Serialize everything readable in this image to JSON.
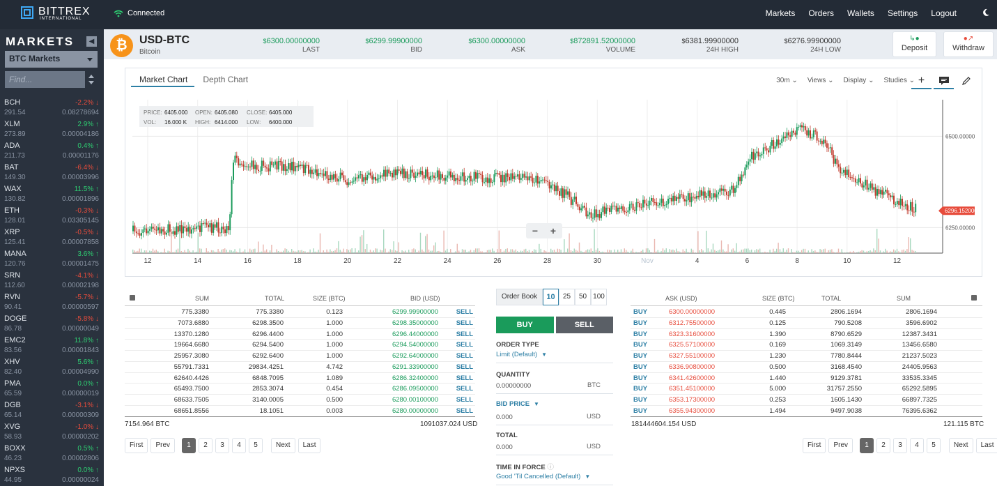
{
  "brand": {
    "name": "BITTREX",
    "sub": "INTERNATIONAL"
  },
  "connection": "Connected",
  "nav": [
    "Markets",
    "Orders",
    "Wallets",
    "Settings",
    "Logout"
  ],
  "sidebar": {
    "title": "MARKETS",
    "select": "BTC Markets",
    "find_placeholder": "Find...",
    "markets": [
      {
        "sym": "BCH",
        "chg": "-2.2%",
        "dir": "down",
        "vol": "291.54",
        "price": "0.08278694"
      },
      {
        "sym": "XLM",
        "chg": "2.9%",
        "dir": "up",
        "vol": "273.89",
        "price": "0.00004186"
      },
      {
        "sym": "ADA",
        "chg": "0.4%",
        "dir": "up",
        "vol": "211.73",
        "price": "0.00001176"
      },
      {
        "sym": "BAT",
        "chg": "-6.4%",
        "dir": "down",
        "vol": "149.30",
        "price": "0.00003996"
      },
      {
        "sym": "WAX",
        "chg": "11.5%",
        "dir": "up",
        "vol": "130.82",
        "price": "0.00001896"
      },
      {
        "sym": "ETH",
        "chg": "-0.3%",
        "dir": "down",
        "vol": "128.01",
        "price": "0.03305145"
      },
      {
        "sym": "XRP",
        "chg": "-0.5%",
        "dir": "down",
        "vol": "125.41",
        "price": "0.00007858"
      },
      {
        "sym": "MANA",
        "chg": "3.6%",
        "dir": "up",
        "vol": "120.76",
        "price": "0.00001475"
      },
      {
        "sym": "SRN",
        "chg": "-4.1%",
        "dir": "down",
        "vol": "112.60",
        "price": "0.00002198"
      },
      {
        "sym": "RVN",
        "chg": "-5.7%",
        "dir": "down",
        "vol": "90.41",
        "price": "0.00000597"
      },
      {
        "sym": "DOGE",
        "chg": "-5.8%",
        "dir": "down",
        "vol": "86.78",
        "price": "0.00000049"
      },
      {
        "sym": "EMC2",
        "chg": "11.8%",
        "dir": "up",
        "vol": "83.56",
        "price": "0.00001843"
      },
      {
        "sym": "XHV",
        "chg": "5.6%",
        "dir": "up",
        "vol": "82.40",
        "price": "0.00004990"
      },
      {
        "sym": "PMA",
        "chg": "0.0%",
        "dir": "zero",
        "vol": "65.59",
        "price": "0.00000019"
      },
      {
        "sym": "DGB",
        "chg": "-3.1%",
        "dir": "down",
        "vol": "65.14",
        "price": "0.00000309"
      },
      {
        "sym": "XVG",
        "chg": "-1.0%",
        "dir": "down",
        "vol": "58.93",
        "price": "0.00000202"
      },
      {
        "sym": "BOXX",
        "chg": "0.5%",
        "dir": "up",
        "vol": "46.23",
        "price": "0.00002806"
      },
      {
        "sym": "NPXS",
        "chg": "0.0%",
        "dir": "zero",
        "vol": "44.95",
        "price": "0.00000024"
      }
    ]
  },
  "ticker": {
    "pair": "USD-BTC",
    "name": "Bitcoin",
    "stats": [
      {
        "cur": "$",
        "value": "6300.00000000",
        "label": "LAST",
        "green": true
      },
      {
        "cur": "$",
        "value": "6299.99900000",
        "label": "BID",
        "green": true
      },
      {
        "cur": "$",
        "value": "6300.00000000",
        "label": "ASK",
        "green": true
      },
      {
        "cur": "$",
        "value": "872891.52000000",
        "label": "VOLUME",
        "green": true
      },
      {
        "cur": "$",
        "value": "6381.99900000",
        "label": "24H HIGH",
        "green": false
      },
      {
        "cur": "$",
        "value": "6276.99900000",
        "label": "24H LOW",
        "green": false
      }
    ],
    "deposit": "Deposit",
    "withdraw": "Withdraw"
  },
  "chart": {
    "tabs": [
      "Market Chart",
      "Depth Chart"
    ],
    "tools": [
      "30m",
      "Views",
      "Display",
      "Studies"
    ],
    "ohlc": {
      "price": "6405.000",
      "open": "6405.080",
      "close": "6405.000",
      "vol": "16.000 K",
      "high": "6414.000",
      "low": "6400.000"
    },
    "ohlc_labels": {
      "price": "PRICE:",
      "open": "OPEN:",
      "close": "CLOSE:",
      "vol": "VOL:",
      "high": "HIGH:",
      "low": "LOW:"
    },
    "y_labels": [
      "6500.000000",
      "6250.000000"
    ],
    "current_price_tag": "6296.152000",
    "x_labels": [
      "12",
      "14",
      "16",
      "18",
      "20",
      "22",
      "24",
      "26",
      "28",
      "30",
      "Nov",
      "4",
      "6",
      "8",
      "10",
      "12"
    ],
    "zoom_out": "−",
    "zoom_in": "+"
  },
  "chart_data": {
    "type": "line",
    "title": "",
    "xlabel": "",
    "ylabel": "",
    "x": [
      "12",
      "14",
      "15.3",
      "15.6",
      "16",
      "18",
      "20",
      "22",
      "24",
      "26",
      "28",
      "29.5",
      "30",
      "Nov 1",
      "4",
      "5.5",
      "6.9",
      "8",
      "8.5",
      "10",
      "11.7"
    ],
    "values": [
      6240,
      6250,
      6250,
      6440,
      6420,
      6415,
      6380,
      6400,
      6390,
      6385,
      6382,
      6300,
      6285,
      6315,
      6350,
      6440,
      6520,
      6490,
      6420,
      6360,
      6300
    ],
    "ylim": [
      6180,
      6600
    ],
    "grid": true
  },
  "bids": {
    "headers": {
      "sum": "SUM",
      "total": "TOTAL",
      "size": "SIZE (BTC)",
      "bid": "BID (USD)"
    },
    "rows": [
      {
        "sum": "775.3380",
        "total": "775.3380",
        "size": "0.123",
        "bid": "6299.99900000",
        "action": "SELL"
      },
      {
        "sum": "7073.6880",
        "total": "6298.3500",
        "size": "1.000",
        "bid": "6298.35000000",
        "action": "SELL"
      },
      {
        "sum": "13370.1280",
        "total": "6296.4400",
        "size": "1.000",
        "bid": "6296.44000000",
        "action": "SELL"
      },
      {
        "sum": "19664.6680",
        "total": "6294.5400",
        "size": "1.000",
        "bid": "6294.54000000",
        "action": "SELL"
      },
      {
        "sum": "25957.3080",
        "total": "6292.6400",
        "size": "1.000",
        "bid": "6292.64000000",
        "action": "SELL"
      },
      {
        "sum": "55791.7331",
        "total": "29834.4251",
        "size": "4.742",
        "bid": "6291.33900000",
        "action": "SELL"
      },
      {
        "sum": "62640.4426",
        "total": "6848.7095",
        "size": "1.089",
        "bid": "6286.32400000",
        "action": "SELL"
      },
      {
        "sum": "65493.7500",
        "total": "2853.3074",
        "size": "0.454",
        "bid": "6286.09500000",
        "action": "SELL"
      },
      {
        "sum": "68633.7505",
        "total": "3140.0005",
        "size": "0.500",
        "bid": "6280.00100000",
        "action": "SELL"
      },
      {
        "sum": "68651.8556",
        "total": "18.1051",
        "size": "0.003",
        "bid": "6280.00000000",
        "action": "SELL"
      }
    ],
    "footer_left": "7154.964 BTC",
    "footer_right": "1091037.024 USD"
  },
  "asks": {
    "headers": {
      "ask": "ASK (USD)",
      "size": "SIZE (BTC)",
      "total": "TOTAL",
      "sum": "SUM"
    },
    "rows": [
      {
        "action": "BUY",
        "ask": "6300.00000000",
        "size": "0.445",
        "total": "2806.1694",
        "sum": "2806.1694"
      },
      {
        "action": "BUY",
        "ask": "6312.75500000",
        "size": "0.125",
        "total": "790.5208",
        "sum": "3596.6902"
      },
      {
        "action": "BUY",
        "ask": "6323.31600000",
        "size": "1.390",
        "total": "8790.6529",
        "sum": "12387.3431"
      },
      {
        "action": "BUY",
        "ask": "6325.57100000",
        "size": "0.169",
        "total": "1069.3149",
        "sum": "13456.6580"
      },
      {
        "action": "BUY",
        "ask": "6327.55100000",
        "size": "1.230",
        "total": "7780.8444",
        "sum": "21237.5023"
      },
      {
        "action": "BUY",
        "ask": "6336.90800000",
        "size": "0.500",
        "total": "3168.4540",
        "sum": "24405.9563"
      },
      {
        "action": "BUY",
        "ask": "6341.42600000",
        "size": "1.440",
        "total": "9129.3781",
        "sum": "33535.3345"
      },
      {
        "action": "BUY",
        "ask": "6351.45100000",
        "size": "5.000",
        "total": "31757.2550",
        "sum": "65292.5895"
      },
      {
        "action": "BUY",
        "ask": "6353.17300000",
        "size": "0.253",
        "total": "1605.1430",
        "sum": "66897.7325"
      },
      {
        "action": "BUY",
        "ask": "6355.94300000",
        "size": "1.494",
        "total": "9497.9038",
        "sum": "76395.6362"
      }
    ],
    "footer_left": "181444604.154 USD",
    "footer_right": "121.115 BTC"
  },
  "pagination": {
    "first": "First",
    "prev": "Prev",
    "pages": [
      "1",
      "2",
      "3",
      "4",
      "5"
    ],
    "next": "Next",
    "last": "Last"
  },
  "order_form": {
    "book_label": "Order Book",
    "depths": [
      "10",
      "25",
      "50",
      "100"
    ],
    "buy": "BUY",
    "sell": "SELL",
    "order_type_label": "ORDER TYPE",
    "order_type_value": "Limit (Default)",
    "quantity_label": "QUANTITY",
    "quantity_value": "0.00000000",
    "quantity_unit": "BTC",
    "bid_price_label": "BID PRICE",
    "bid_price_value": "0.000",
    "bid_price_unit": "USD",
    "total_label": "TOTAL",
    "total_value": "0.000",
    "total_unit": "USD",
    "tif_label": "TIME IN FORCE",
    "tif_value": "Good 'Til Cancelled (Default)"
  },
  "colors": {
    "green": "#1a9b5b",
    "red": "#e74c3c",
    "blue": "#2d7fa5",
    "sidebar": "#2a323e",
    "topbar": "#232b36"
  }
}
